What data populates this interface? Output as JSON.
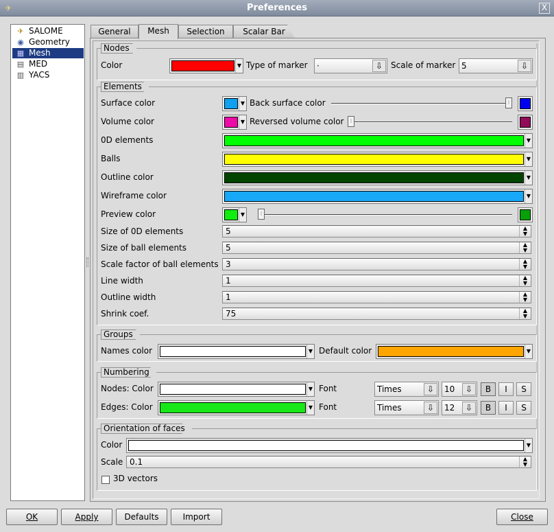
{
  "window": {
    "title": "Preferences",
    "close_glyph": "X"
  },
  "tree": [
    {
      "label": "SALOME",
      "icon": "salome-icon",
      "glyph": "✈",
      "selected": false
    },
    {
      "label": "Geometry",
      "icon": "geometry-icon",
      "glyph": "◉",
      "selected": false
    },
    {
      "label": "Mesh",
      "icon": "mesh-icon",
      "glyph": "▦",
      "selected": true
    },
    {
      "label": "MED",
      "icon": "med-icon",
      "glyph": "▤",
      "selected": false
    },
    {
      "label": "YACS",
      "icon": "yacs-icon",
      "glyph": "▥",
      "selected": false
    }
  ],
  "tabs": [
    "General",
    "Mesh",
    "Selection",
    "Scalar Bar"
  ],
  "active_tab": "Mesh",
  "nodes": {
    "title": "Nodes",
    "color_label": "Color",
    "color": "#ff0000",
    "type_label": "Type of marker",
    "type_value": "·",
    "scale_label": "Scale of marker",
    "scale_value": "5"
  },
  "elements": {
    "title": "Elements",
    "surface_label": "Surface color",
    "surface_color": "#10a0f0",
    "back_label": "Back surface color",
    "back_color": "#0000f0",
    "back_slider": 1.0,
    "volume_label": "Volume color",
    "volume_color": "#ee0aa8",
    "reversed_label": "Reversed volume color",
    "reversed_color": "#920c5a",
    "reversed_slider": 0.0,
    "zero_d_label": "0D elements",
    "zero_d_color": "#00ff00",
    "balls_label": "Balls",
    "balls_color": "#ffff00",
    "outline_label": "Outline color",
    "outline_color": "#004400",
    "wireframe_label": "Wireframe color",
    "wireframe_color": "#18a8f8",
    "preview_label": "Preview color",
    "preview_color": "#10ee10",
    "preview_color2": "#08a008",
    "preview_slider": 0.0,
    "size0d_label": "Size of 0D elements",
    "size0d_value": "5",
    "sizeball_label": "Size of ball elements",
    "sizeball_value": "5",
    "scaleball_label": "Scale factor of ball elements",
    "scaleball_value": "3",
    "linewidth_label": "Line width",
    "linewidth_value": "1",
    "outlinewidth_label": "Outline width",
    "outlinewidth_value": "1",
    "shrink_label": "Shrink coef.",
    "shrink_value": "75"
  },
  "groups": {
    "title": "Groups",
    "names_label": "Names color",
    "names_color": "#ffffff",
    "default_label": "Default color",
    "default_color": "#ffa500"
  },
  "numbering": {
    "title": "Numbering",
    "nodes_label": "Nodes: Color",
    "nodes_color": "#ffffff",
    "nodes_font_label": "Font",
    "nodes_font": "Times",
    "nodes_size": "10",
    "edges_label": "Edges: Color",
    "edges_color": "#18e818",
    "edges_font_label": "Font",
    "edges_font": "Times",
    "edges_size": "12",
    "bold": "B",
    "italic": "I",
    "shadow": "S"
  },
  "orientation": {
    "title": "Orientation of faces",
    "color_label": "Color",
    "color": "#ffffff",
    "scale_label": "Scale",
    "scale_value": "0.1",
    "vectors_label": "3D vectors",
    "vectors_checked": false
  },
  "buttons": {
    "ok": "OK",
    "apply": "Apply",
    "defaults": "Defaults",
    "import": "Import",
    "close": "Close"
  }
}
